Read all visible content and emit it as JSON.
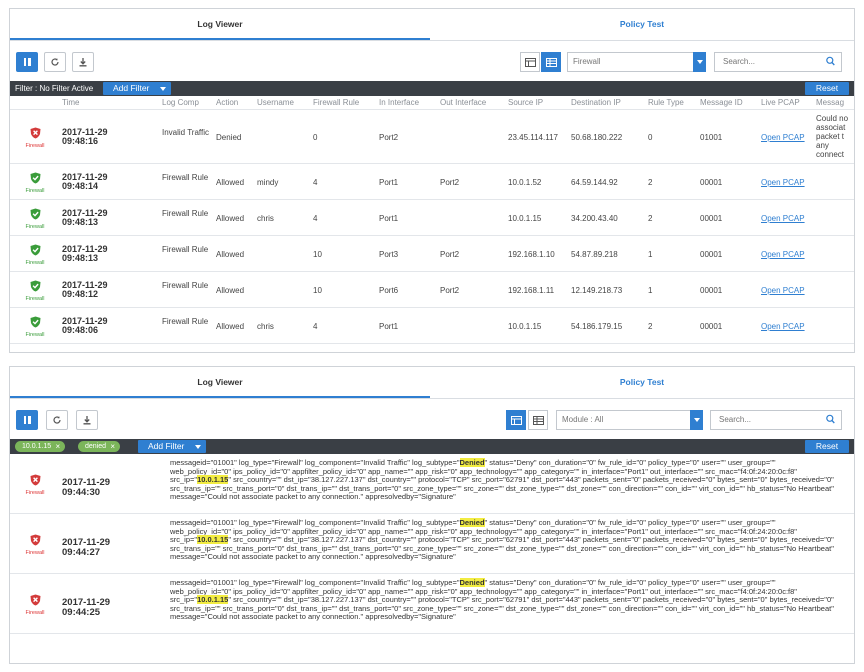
{
  "colors": {
    "accent": "#2f7fd1",
    "filter_bar": "#3a3f45",
    "chip": "#7bb55a",
    "highlight": "#f2ec42",
    "denied_icon": "#d33b3b",
    "allowed_icon": "#3a9c3a"
  },
  "top": {
    "tabs": [
      "Log Viewer",
      "Policy Test"
    ],
    "module_select": "Firewall",
    "search_placeholder": "Search...",
    "filter_status": "Filter : No Filter Active",
    "add_filter": "Add Filter",
    "reset": "Reset",
    "columns": [
      "Time",
      "Log Comp",
      "Action",
      "Username",
      "Firewall Rule",
      "In Interface",
      "Out Interface",
      "Source IP",
      "Destination IP",
      "Rule Type",
      "Message ID",
      "Live PCAP",
      "Messag"
    ],
    "rows": [
      {
        "icon": "firewall-denied-icon",
        "icon_label": "Firewall",
        "date": "2017-11-29",
        "clock": "09:48:16",
        "log_comp": "Invalid Traffic",
        "action": "Denied",
        "username": "",
        "rule": "0",
        "in_if": "Port2",
        "out_if": "",
        "src": "23.45.114.117",
        "dst": "50.68.180.222",
        "rule_type": "0",
        "msg_id": "01001",
        "pcap": "Open PCAP",
        "message": "Could no associat packet t any connect"
      },
      {
        "icon": "firewall-allowed-icon",
        "icon_label": "Firewall",
        "date": "2017-11-29",
        "clock": "09:48:14",
        "log_comp": "Firewall Rule",
        "action": "Allowed",
        "username": "mindy",
        "rule": "4",
        "in_if": "Port1",
        "out_if": "Port2",
        "src": "10.0.1.52",
        "dst": "64.59.144.92",
        "rule_type": "2",
        "msg_id": "00001",
        "pcap": "Open PCAP",
        "message": ""
      },
      {
        "icon": "firewall-allowed-icon",
        "icon_label": "Firewall",
        "date": "2017-11-29",
        "clock": "09:48:13",
        "log_comp": "Firewall Rule",
        "action": "Allowed",
        "username": "chris",
        "rule": "4",
        "in_if": "Port1",
        "out_if": "",
        "src": "10.0.1.15",
        "dst": "34.200.43.40",
        "rule_type": "2",
        "msg_id": "00001",
        "pcap": "Open PCAP",
        "message": ""
      },
      {
        "icon": "firewall-allowed-icon",
        "icon_label": "Firewall",
        "date": "2017-11-29",
        "clock": "09:48:13",
        "log_comp": "Firewall Rule",
        "action": "Allowed",
        "username": "",
        "rule": "10",
        "in_if": "Port3",
        "out_if": "Port2",
        "src": "192.168.1.10",
        "dst": "54.87.89.218",
        "rule_type": "1",
        "msg_id": "00001",
        "pcap": "Open PCAP",
        "message": ""
      },
      {
        "icon": "firewall-allowed-icon",
        "icon_label": "Firewall",
        "date": "2017-11-29",
        "clock": "09:48:12",
        "log_comp": "Firewall Rule",
        "action": "Allowed",
        "username": "",
        "rule": "10",
        "in_if": "Port6",
        "out_if": "Port2",
        "src": "192.168.1.11",
        "dst": "12.149.218.73",
        "rule_type": "1",
        "msg_id": "00001",
        "pcap": "Open PCAP",
        "message": ""
      },
      {
        "icon": "firewall-allowed-icon",
        "icon_label": "Firewall",
        "date": "2017-11-29",
        "clock": "09:48:06",
        "log_comp": "Firewall Rule",
        "action": "Allowed",
        "username": "chris",
        "rule": "4",
        "in_if": "Port1",
        "out_if": "",
        "src": "10.0.1.15",
        "dst": "54.186.179.15",
        "rule_type": "2",
        "msg_id": "00001",
        "pcap": "Open PCAP",
        "message": ""
      }
    ]
  },
  "bottom": {
    "tabs": [
      "Log Viewer",
      "Policy Test"
    ],
    "module_select": "Module : All",
    "search_placeholder": "Search...",
    "chips": [
      "10.0.1.15",
      "denied"
    ],
    "add_filter": "Add Filter",
    "reset": "Reset",
    "entries": [
      {
        "icon": "firewall-denied-icon",
        "icon_label": "Firewall",
        "date": "2017-11-29",
        "clock": "09:44:30",
        "pre": "messageid=\"01001\" log_type=\"Firewall\" log_component=\"Invalid Traffic\" log_subtype=\"",
        "hl1": "Denied",
        "mid": "\" status=\"Deny\" con_duration=\"0\" fw_rule_id=\"0\" policy_type=\"0\" user=\"\" user_group=\"\" web_policy_id=\"0\" ips_policy_id=\"0\" appfilter_policy_id=\"0\" app_name=\"\" app_risk=\"0\" app_technology=\"\" app_category=\"\" in_interface=\"Port1\" out_interface=\"\" src_mac=\"f4:0f:24:20:0c:f8\" src_ip=\"",
        "hl2": "10.0.1.15",
        "post": "\" src_country=\"\" dst_ip=\"38.127.227.137\" dst_country=\"\" protocol=\"TCP\" src_port=\"62791\" dst_port=\"443\" packets_sent=\"0\" packets_received=\"0\" bytes_sent=\"0\" bytes_received=\"0\" src_trans_ip=\"\" src_trans_port=\"0\" dst_trans_ip=\"\" dst_trans_port=\"0\" src_zone_type=\"\" src_zone=\"\" dst_zone_type=\"\" dst_zone=\"\" con_direction=\"\" con_id=\"\" virt_con_id=\"\" hb_status=\"No Heartbeat\" message=\"Could not associate packet to any connection.\" appresolvedby=\"Signature\""
      },
      {
        "icon": "firewall-denied-icon",
        "icon_label": "Firewall",
        "date": "2017-11-29",
        "clock": "09:44:27",
        "pre": "messageid=\"01001\" log_type=\"Firewall\" log_component=\"Invalid Traffic\" log_subtype=\"",
        "hl1": "Denied",
        "mid": "\" status=\"Deny\" con_duration=\"0\" fw_rule_id=\"0\" policy_type=\"0\" user=\"\" user_group=\"\" web_policy_id=\"0\" ips_policy_id=\"0\" appfilter_policy_id=\"0\" app_name=\"\" app_risk=\"0\" app_technology=\"\" app_category=\"\" in_interface=\"Port1\" out_interface=\"\" src_mac=\"f4:0f:24:20:0c:f8\" src_ip=\"",
        "hl2": "10.0.1.15",
        "post": "\" src_country=\"\" dst_ip=\"38.127.227.137\" dst_country=\"\" protocol=\"TCP\" src_port=\"62791\" dst_port=\"443\" packets_sent=\"0\" packets_received=\"0\" bytes_sent=\"0\" bytes_received=\"0\" src_trans_ip=\"\" src_trans_port=\"0\" dst_trans_ip=\"\" dst_trans_port=\"0\" src_zone_type=\"\" src_zone=\"\" dst_zone_type=\"\" dst_zone=\"\" con_direction=\"\" con_id=\"\" virt_con_id=\"\" hb_status=\"No Heartbeat\" message=\"Could not associate packet to any connection.\" appresolvedby=\"Signature\""
      },
      {
        "icon": "firewall-denied-icon",
        "icon_label": "Firewall",
        "date": "2017-11-29",
        "clock": "09:44:25",
        "pre": "messageid=\"01001\" log_type=\"Firewall\" log_component=\"Invalid Traffic\" log_subtype=\"",
        "hl1": "Denied",
        "mid": "\" status=\"Deny\" con_duration=\"0\" fw_rule_id=\"0\" policy_type=\"0\" user=\"\" user_group=\"\" web_policy_id=\"0\" ips_policy_id=\"0\" appfilter_policy_id=\"0\" app_name=\"\" app_risk=\"0\" app_technology=\"\" app_category=\"\" in_interface=\"Port1\" out_interface=\"\" src_mac=\"f4:0f:24:20:0c:f8\" src_ip=\"",
        "hl2": "10.0.1.15",
        "post": "\" src_country=\"\" dst_ip=\"38.127.227.137\" dst_country=\"\" protocol=\"TCP\" src_port=\"62791\" dst_port=\"443\" packets_sent=\"0\" packets_received=\"0\" bytes_sent=\"0\" bytes_received=\"0\" src_trans_ip=\"\" src_trans_port=\"0\" dst_trans_ip=\"\" dst_trans_port=\"0\" src_zone_type=\"\" src_zone=\"\" dst_zone_type=\"\" dst_zone=\"\" con_direction=\"\" con_id=\"\" virt_con_id=\"\" hb_status=\"No Heartbeat\" message=\"Could not associate packet to any connection.\" appresolvedby=\"Signature\""
      }
    ]
  }
}
